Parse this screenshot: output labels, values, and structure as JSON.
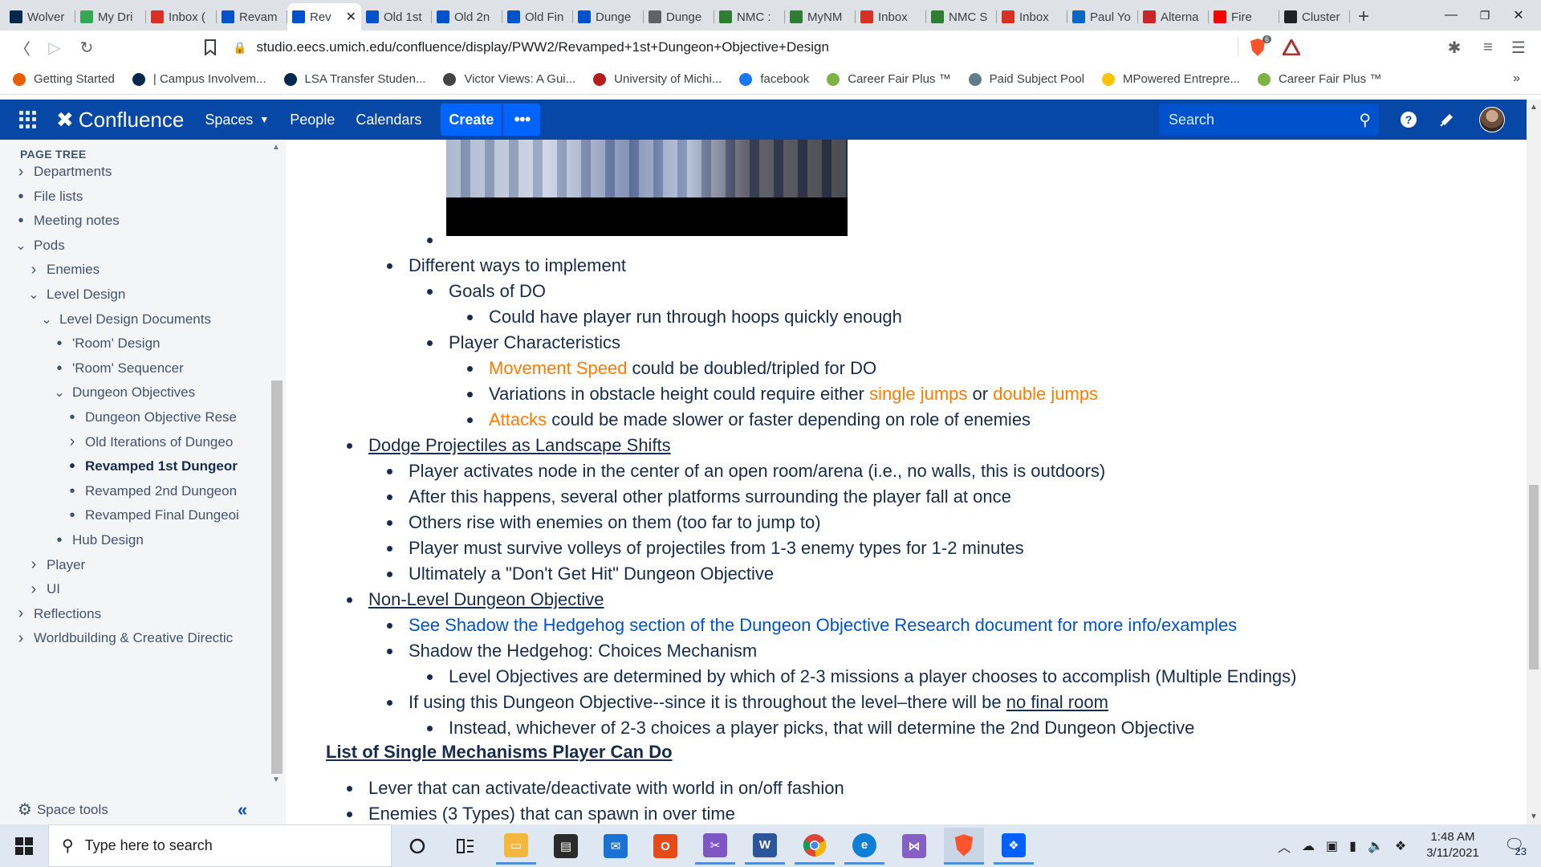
{
  "browser": {
    "tabs": [
      {
        "label": "Wolver",
        "icon": "michigan-icon",
        "color": "#00274c"
      },
      {
        "label": "My Dri",
        "icon": "google-drive-icon",
        "color": "#34a853"
      },
      {
        "label": "Inbox (",
        "icon": "gmail-icon",
        "color": "#d93025"
      },
      {
        "label": "Revam",
        "icon": "confluence-icon",
        "color": "#0052cc"
      },
      {
        "label": "Rev",
        "icon": "confluence-icon",
        "color": "#0052cc",
        "active": true
      },
      {
        "label": "Old 1st",
        "icon": "confluence-icon",
        "color": "#0052cc"
      },
      {
        "label": "Old 2n",
        "icon": "confluence-icon",
        "color": "#0052cc"
      },
      {
        "label": "Old Fin",
        "icon": "confluence-icon",
        "color": "#0052cc"
      },
      {
        "label": "Dunge",
        "icon": "confluence-icon",
        "color": "#0052cc"
      },
      {
        "label": "Dunge",
        "icon": "globe-icon",
        "color": "#5f6368"
      },
      {
        "label": "NMC :",
        "icon": "nmc-icon",
        "color": "#2e7d32"
      },
      {
        "label": "MyNM",
        "icon": "nmc-icon",
        "color": "#2e7d32"
      },
      {
        "label": "Inbox",
        "icon": "gmail-icon",
        "color": "#d93025"
      },
      {
        "label": "NMC S",
        "icon": "nmc-icon",
        "color": "#2e7d32"
      },
      {
        "label": "Inbox",
        "icon": "gmail-icon",
        "color": "#d93025"
      },
      {
        "label": "Paul Yo",
        "icon": "linkedin-icon",
        "color": "#0a66c2"
      },
      {
        "label": "Alterna",
        "icon": "b-icon",
        "color": "#c62828"
      },
      {
        "label": "Fire",
        "icon": "youtube-icon",
        "color": "#ff0000"
      },
      {
        "label": "Cluster",
        "icon": "wikipedia-icon",
        "color": "#202124"
      }
    ],
    "close_glyph": "✕",
    "new_tab": "+",
    "url": "studio.eecs.umich.edu/confluence/display/PWW2/Revamped+1st+Dungeon+Objective+Design",
    "shield_count": "6",
    "bookmarks": [
      {
        "label": "Getting Started",
        "icon": "firefox-icon",
        "color": "#e66000"
      },
      {
        "label": "| Campus Involvem...",
        "icon": "michigan-icon",
        "color": "#00274c"
      },
      {
        "label": "LSA Transfer Studen...",
        "icon": "lsa-icon",
        "color": "#00274c"
      },
      {
        "label": "Victor Views: A Gui...",
        "icon": "victor-icon",
        "color": "#444444"
      },
      {
        "label": "University of Michi...",
        "icon": "umich-icon",
        "color": "#b71c1c"
      },
      {
        "label": "facebook",
        "icon": "facebook-icon",
        "color": "#1877f2"
      },
      {
        "label": "Career Fair Plus ™",
        "icon": "careerfair-icon",
        "color": "#7cb342"
      },
      {
        "label": "Paid Subject Pool",
        "icon": "subjectpool-icon",
        "color": "#607d8b"
      },
      {
        "label": "MPowered Entrepre...",
        "icon": "hexagon-icon",
        "color": "#ffc400"
      },
      {
        "label": "Career Fair Plus ™",
        "icon": "careerfair-icon",
        "color": "#7cb342"
      }
    ]
  },
  "confluence": {
    "logo": "Confluence",
    "nav": {
      "spaces": "Spaces",
      "people": "People",
      "calendars": "Calendars"
    },
    "create": "Create",
    "more": "•••",
    "search_placeholder": "Search",
    "brand_color": "#0747a6"
  },
  "sidebar": {
    "title": "PAGE TREE",
    "items": [
      {
        "label": "Departments",
        "twisty": "collapsed",
        "depth": 0
      },
      {
        "label": "File lists",
        "twisty": "leaf",
        "depth": 0
      },
      {
        "label": "Meeting notes",
        "twisty": "leaf",
        "depth": 0
      },
      {
        "label": "Pods",
        "twisty": "expanded",
        "depth": 0
      },
      {
        "label": "Enemies",
        "twisty": "collapsed",
        "depth": 1
      },
      {
        "label": "Level Design",
        "twisty": "expanded",
        "depth": 1
      },
      {
        "label": "Level Design Documents",
        "twisty": "expanded",
        "depth": 2
      },
      {
        "label": "'Room' Design",
        "twisty": "leaf",
        "depth": 3
      },
      {
        "label": "'Room' Sequencer",
        "twisty": "leaf",
        "depth": 3
      },
      {
        "label": "Dungeon Objectives",
        "twisty": "expanded",
        "depth": 3
      },
      {
        "label": "Dungeon Objective Rese",
        "twisty": "leaf",
        "depth": 4
      },
      {
        "label": "Old Iterations of Dungeo",
        "twisty": "collapsed",
        "depth": 4
      },
      {
        "label": "Revamped 1st Dungeor",
        "twisty": "leaf",
        "depth": 4,
        "current": true
      },
      {
        "label": "Revamped 2nd Dungeon",
        "twisty": "leaf",
        "depth": 4
      },
      {
        "label": "Revamped Final Dungeoi",
        "twisty": "leaf",
        "depth": 4
      },
      {
        "label": "Hub Design",
        "twisty": "leaf",
        "depth": 3
      },
      {
        "label": "Player",
        "twisty": "collapsed",
        "depth": 1
      },
      {
        "label": "UI",
        "twisty": "collapsed",
        "depth": 1
      },
      {
        "label": "Reflections",
        "twisty": "collapsed",
        "depth": 0
      },
      {
        "label": "Worldbuilding & Creative Directic",
        "twisty": "collapsed",
        "depth": 0
      }
    ],
    "space_tools": "Space tools",
    "collapse": "«"
  },
  "content": {
    "different_ways": "Different ways to implement",
    "goals": "Goals of DO",
    "goals_1": "Could have player run through hoops quickly enough",
    "player_chars": "Player Characteristics",
    "movement_speed": "Movement Speed",
    "movement_rest": " could be doubled/tripled for DO",
    "variations_a": "Variations in obstacle height could require either ",
    "single_jumps": "single jumps",
    "or": " or ",
    "double_jumps": "double jumps",
    "attacks": "Attacks",
    "attacks_rest": " could be made slower or faster depending on role of enemies",
    "dodge_title": "Dodge Projectiles as Landscape Shifts",
    "dodge_1": "Player activates node in the center of an open room/arena (i.e., no walls, this is outdoors)",
    "dodge_2": "After this happens, several other platforms surrounding the player fall at once",
    "dodge_3": "Others rise with enemies on them (too far to jump to)",
    "dodge_4": "Player must survive volleys of projectiles from 1-3 enemy types for 1-2 minutes",
    "dodge_5": "Ultimately a \"Don't Get Hit\" Dungeon Objective",
    "nonlevel_title": "Non-Level Dungeon Objective",
    "nonlevel_link": "See Shadow the Hedgehog section of the Dungeon Objective Research document for more info/examples",
    "nonlevel_2": "Shadow the Hedgehog: Choices Mechanism",
    "nonlevel_2a": "Level Objectives are determined by which of 2-3 missions a player chooses to accomplish (Multiple Endings)",
    "nonlevel_3a": "If using this Dungeon Objective--since it is throughout the level–there will be ",
    "nonlevel_3u": "no final room",
    "nonlevel_3b": "Instead, whichever of 2-3 choices a player picks, that will determine the 2nd Dungeon Objective",
    "list_heading": "List of Single Mechanisms Player Can Do",
    "list_1": "Lever that can activate/deactivate with world in on/off fashion",
    "list_2": "Enemies (3 Types) that can spawn in over time",
    "accent_orange": "#ff7b00",
    "link_blue": "#0052cc"
  },
  "taskbar": {
    "search_placeholder": "Type here to search",
    "time": "1:48 AM",
    "date": "3/11/2021",
    "notifications": "23",
    "apps": [
      "cortana-icon",
      "task-view-icon",
      "file-explorer-icon",
      "store-icon",
      "mail-icon",
      "office-icon",
      "snip-icon",
      "word-icon",
      "chrome-icon",
      "edge-icon",
      "visual-studio-icon",
      "brave-icon",
      "dropbox-icon"
    ]
  }
}
